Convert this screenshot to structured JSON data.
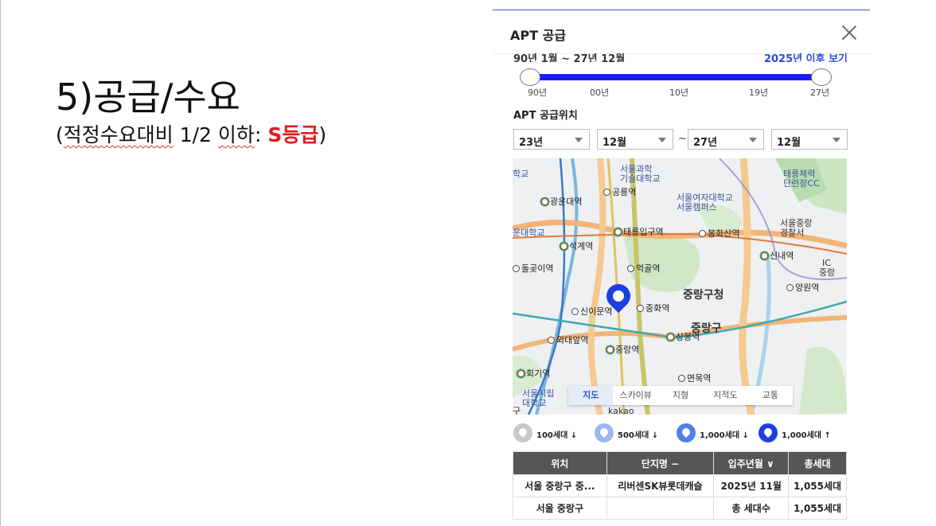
{
  "slide": {
    "title": "5)공급/수요",
    "subtitle_prefix": "(",
    "subtitle_main": "적정수요대비",
    "subtitle_mid": " 1/2 ",
    "subtitle_word": "이하",
    "subtitle_colon": ": ",
    "subtitle_grade": "S등급",
    "subtitle_suffix": ")",
    "grade_color": "#e21b1b"
  },
  "panel": {
    "title": "APT 공급",
    "close_icon": "close-icon",
    "range_text": "90년 1월 ~ 27년 12월",
    "range_link": "2025년 이후 보기",
    "slider": {
      "ticks": [
        "90년",
        "00년",
        "10년",
        "19년",
        "27년"
      ],
      "track_color": "#1a1aff"
    },
    "section_label": "APT 공급위치",
    "selects": {
      "start_year": "23년",
      "start_month": "12월",
      "separator": "~",
      "end_year": "27년",
      "end_month": "12월"
    }
  },
  "map": {
    "labels": {
      "univ_science": "서울과학\n기술대학교",
      "taereung": "태릉체력\n단련장CC",
      "womens_univ": "서울여자대학교\n서울캠퍼스",
      "police": "서울중랑\n경찰서",
      "district_office": "중랑구청",
      "district": "중랑구",
      "hankuk_left": "학교",
      "univ_left": "운대학교",
      "seoulsi_univ": "서울시립\n대학교",
      "gu_bottom": "구",
      "ic": "IC",
      "jungnang_ic": "중랑",
      "kakao": "kakao"
    },
    "stations": {
      "gwangun": "광운대역",
      "gongneung": "공릉역",
      "taereung_ipgu": "태릉입구역",
      "bonghwasan": "봉화산역",
      "seokgye": "석계역",
      "sinnae": "신내역",
      "dolgoji": "돌곶이역",
      "meokgol": "먹골역",
      "yangwon": "양원역",
      "sinimun": "신이문역",
      "junghwa": "중화역",
      "oedae": "외대앞역",
      "sangbong": "상봉역",
      "jungnang": "중랑역",
      "hoegi": "회기역",
      "myeonmok": "면목역"
    },
    "tabs": [
      "지도",
      "스카이뷰",
      "지형",
      "지적도",
      "교통"
    ],
    "active_tab": "지도",
    "pin_color": "#1b3fe0"
  },
  "legend": [
    {
      "label": "100세대 ↓",
      "color": "#c8c8c8",
      "icon": "pin-icon-gray"
    },
    {
      "label": "500세대 ↓",
      "color": "#9bb7f0",
      "icon": "pin-icon-lightblue"
    },
    {
      "label": "1,000세대 ↓",
      "color": "#4f7fe8",
      "icon": "pin-icon-blue"
    },
    {
      "label": "1,000세대 ↑",
      "color": "#1b3fe0",
      "icon": "pin-icon-darkblue"
    }
  ],
  "table": {
    "headers": [
      "위치",
      "단지명 −",
      "입주년월 ∨",
      "총세대"
    ],
    "rows": [
      [
        "서울 중랑구 중...",
        "리버센SK뷰롯데캐슬",
        "2025년 11월",
        "1,055세대"
      ],
      [
        "서울 중랑구",
        "",
        "총 세대수",
        "1,055세대"
      ]
    ]
  }
}
